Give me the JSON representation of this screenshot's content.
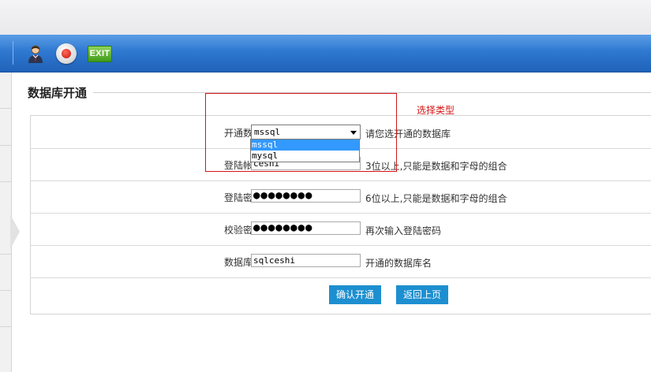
{
  "toolbar": {
    "user_icon": "user-icon",
    "record_icon": "record-icon",
    "exit_label": "EXIT"
  },
  "section": {
    "title": "数据库开通"
  },
  "annotation": {
    "text": "选择类型"
  },
  "form": {
    "db_type": {
      "label": "开通数据：",
      "selected": "mssql",
      "options": [
        "mssql",
        "mysql"
      ],
      "hint": "请您选开通的数据库"
    },
    "login_account": {
      "label": "登陆帐号：",
      "value": "ceshi",
      "hint": "3位以上,只能是数据和字母的组合"
    },
    "login_password": {
      "label": "登陆密码：",
      "value": "●●●●●●●●",
      "hint": "6位以上,只能是数据和字母的组合"
    },
    "confirm_password": {
      "label": "校验密码：",
      "value": "●●●●●●●●",
      "hint": "再次输入登陆密码"
    },
    "db_name": {
      "label": "数据库名：",
      "value": "sqlceshi",
      "hint": "开通的数据库名"
    }
  },
  "buttons": {
    "confirm": "确认开通",
    "back": "返回上页"
  },
  "colors": {
    "toolbar": "#2f78d0",
    "button": "#1d8fd0",
    "annotation": "#d81414",
    "selected_option": "#3399ff"
  }
}
